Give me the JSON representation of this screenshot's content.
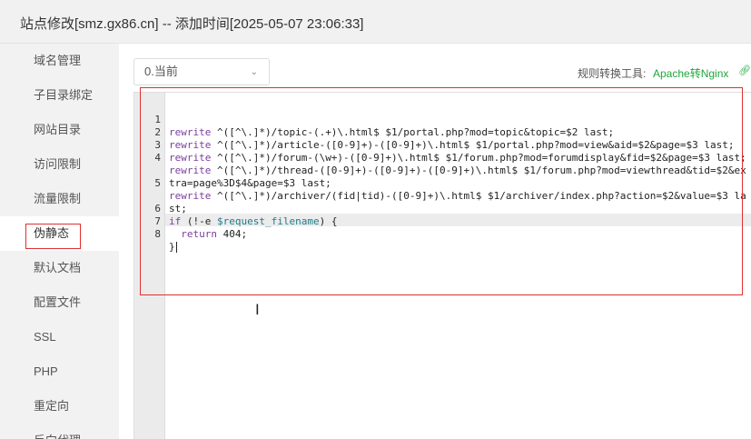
{
  "window": {
    "title": "站点修改[smz.gx86.cn] -- 添加时间[2025-05-07 23:06:33]"
  },
  "sidebar": {
    "items": [
      {
        "label": "域名管理"
      },
      {
        "label": "子目录绑定"
      },
      {
        "label": "网站目录"
      },
      {
        "label": "访问限制"
      },
      {
        "label": "流量限制"
      },
      {
        "label": "伪静态"
      },
      {
        "label": "默认文档"
      },
      {
        "label": "配置文件"
      },
      {
        "label": "SSL"
      },
      {
        "label": "PHP"
      },
      {
        "label": "重定向"
      },
      {
        "label": "反向代理"
      }
    ],
    "active": "伪静态"
  },
  "rewrite": {
    "template_select": "0.当前",
    "tool_label": "规则转换工具:",
    "tool_link": "Apache转Nginx",
    "icon": "external-link-icon"
  },
  "editor": {
    "lines": [
      {
        "num": "1"
      },
      {
        "num": "2"
      },
      {
        "num": "3"
      },
      {
        "num": "4"
      },
      {
        "num": "5"
      },
      {
        "num": "6"
      },
      {
        "num": "7"
      },
      {
        "num": "8"
      }
    ],
    "code": {
      "l1_kw": "rewrite",
      "l1_rest": " ^([^\\.]*)/topic-(.+)\\.html$ $1/portal.php?mod=topic&topic=$2 last;",
      "l2_kw": "rewrite",
      "l2_rest": " ^([^\\.]*)/article-([0-9]+)-([0-9]+)\\.html$ $1/portal.php?mod=view&aid=$2&page=$3 last;",
      "l3_kw": "rewrite",
      "l3_rest": " ^([^\\.]*)/forum-(\\w+)-([0-9]+)\\.html$ $1/forum.php?mod=forumdisplay&fid=$2&page=$3 last;",
      "l4_kw": "rewrite",
      "l4_rest": " ^([^\\.]*)/thread-([0-9]+)-([0-9]+)-([0-9]+)\\.html$ $1/forum.php?mod=viewthread&tid=$2&extra=page%3D$4&page=$3 last;",
      "l5_kw": "rewrite",
      "l5_rest": " ^([^\\.]*)/archiver/(fid|tid)-([0-9]+)\\.html$ $1/archiver/index.php?action=$2&value=$3 last;",
      "l6_kw": "if",
      "l6_a": " (!-e ",
      "l6_var": "$request_filename",
      "l6_b": ") {",
      "l7_kw": "return",
      "l7_rest": " 404;",
      "l8": "}"
    }
  }
}
